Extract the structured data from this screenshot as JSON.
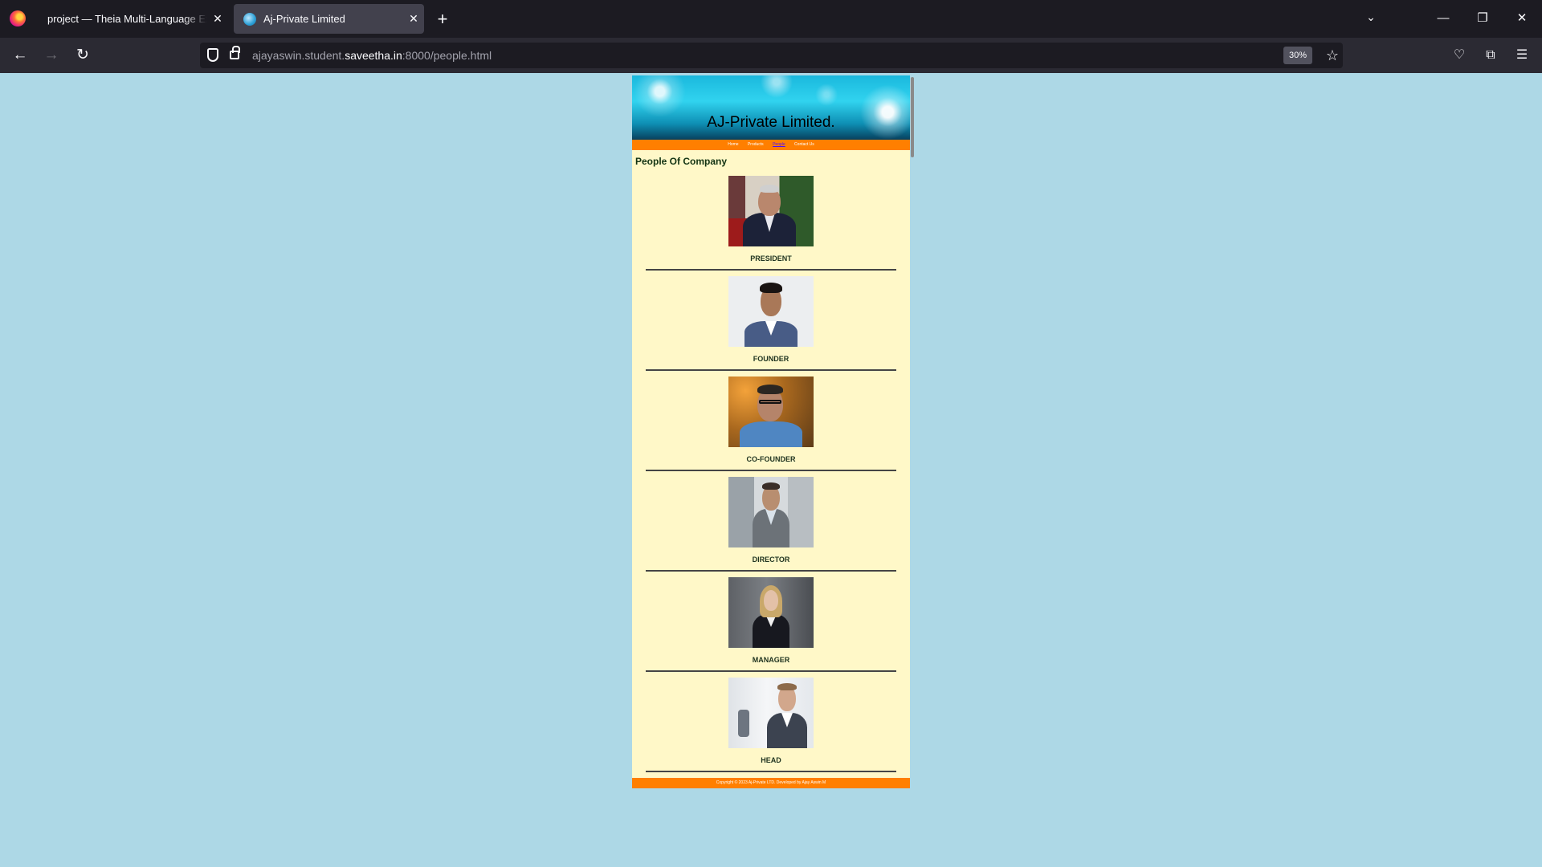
{
  "browser": {
    "tabs": [
      {
        "title": "project — Theia Multi-Language Exam",
        "active": false
      },
      {
        "title": "Aj-Private Limited",
        "active": true
      }
    ],
    "url": {
      "prefix": "ajayaswin.student.",
      "domain": "saveetha.in",
      "suffix": ":8000/people.html"
    },
    "zoom": "30%"
  },
  "page": {
    "banner_title": "AJ-Private Limited.",
    "nav": [
      "Home",
      "Products",
      "People",
      "Contact Us"
    ],
    "current_nav": "People",
    "heading": "People Of Company",
    "people": [
      {
        "role": "PRESIDENT"
      },
      {
        "role": "FOUNDER"
      },
      {
        "role": "CO-FOUNDER"
      },
      {
        "role": "DIRECTOR"
      },
      {
        "role": "MANAGER"
      },
      {
        "role": "HEAD"
      }
    ],
    "footer": "Copyright © 2023 Aj-Private LTD. Developed by Ajay Aswin M"
  },
  "colors": {
    "page_background": "#add8e6",
    "content_background": "#fff8c8",
    "nav_bar": "#ff7f00",
    "banner": "#1ab8dd"
  }
}
